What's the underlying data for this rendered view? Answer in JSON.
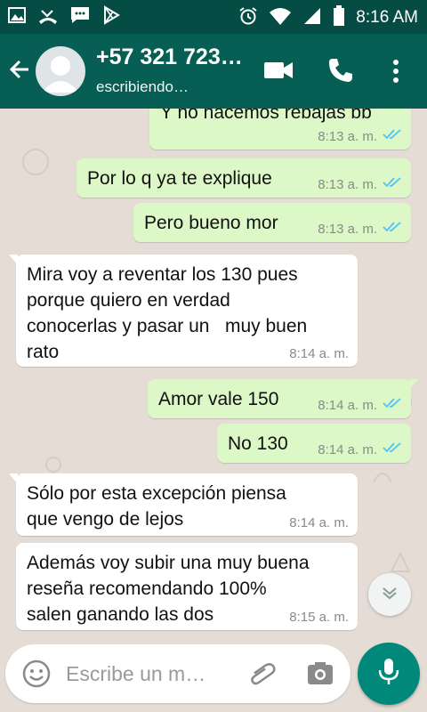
{
  "status_bar": {
    "time": "8:16 AM"
  },
  "header": {
    "contact": "+57 321 723…",
    "status": "escribiendo…"
  },
  "colors": {
    "header": "#075e54",
    "statusbar": "#054d44",
    "outgoing": "#dcf8c6",
    "incoming": "#ffffff",
    "accent": "#00897b",
    "read_tick": "#4fc3f7"
  },
  "messages": [
    {
      "dir": "out",
      "text": "Y no hacemos rebajas bb",
      "time": "8:13 a. m.",
      "read": true
    },
    {
      "dir": "out",
      "text": "Por lo q ya te explique",
      "time": "8:13 a. m.",
      "read": true
    },
    {
      "dir": "out",
      "text": "Pero bueno mor",
      "time": "8:13 a. m.",
      "read": true
    },
    {
      "dir": "in",
      "text": "Mira voy a reventar los 130 pues\nporque quiero en verdad\nconocerlas y pasar un   muy buen\nrato",
      "time": "8:14 a. m."
    },
    {
      "dir": "out",
      "text": "Amor vale 150",
      "time": "8:14 a. m.",
      "read": true
    },
    {
      "dir": "out",
      "text": "No 130",
      "time": "8:14 a. m.",
      "read": true
    },
    {
      "dir": "in",
      "text": "Sólo por esta excepción piensa\nque vengo de lejos",
      "time": "8:14 a. m."
    },
    {
      "dir": "in",
      "text": "Además voy subir una muy buena\nreseña recomendando 100%\nsalen ganando las dos",
      "time": "8:15 a. m."
    }
  ],
  "composer": {
    "placeholder": "Escribe un m…"
  },
  "icons": [
    "gallery-icon",
    "missed-call-icon",
    "message-icon",
    "play-store-icon",
    "alarm-icon",
    "wifi-icon",
    "signal-icon",
    "battery-icon",
    "back-arrow-icon",
    "video-call-icon",
    "phone-icon",
    "more-vert-icon",
    "emoji-icon",
    "attach-icon",
    "camera-icon",
    "mic-icon",
    "chevron-down-icon"
  ]
}
